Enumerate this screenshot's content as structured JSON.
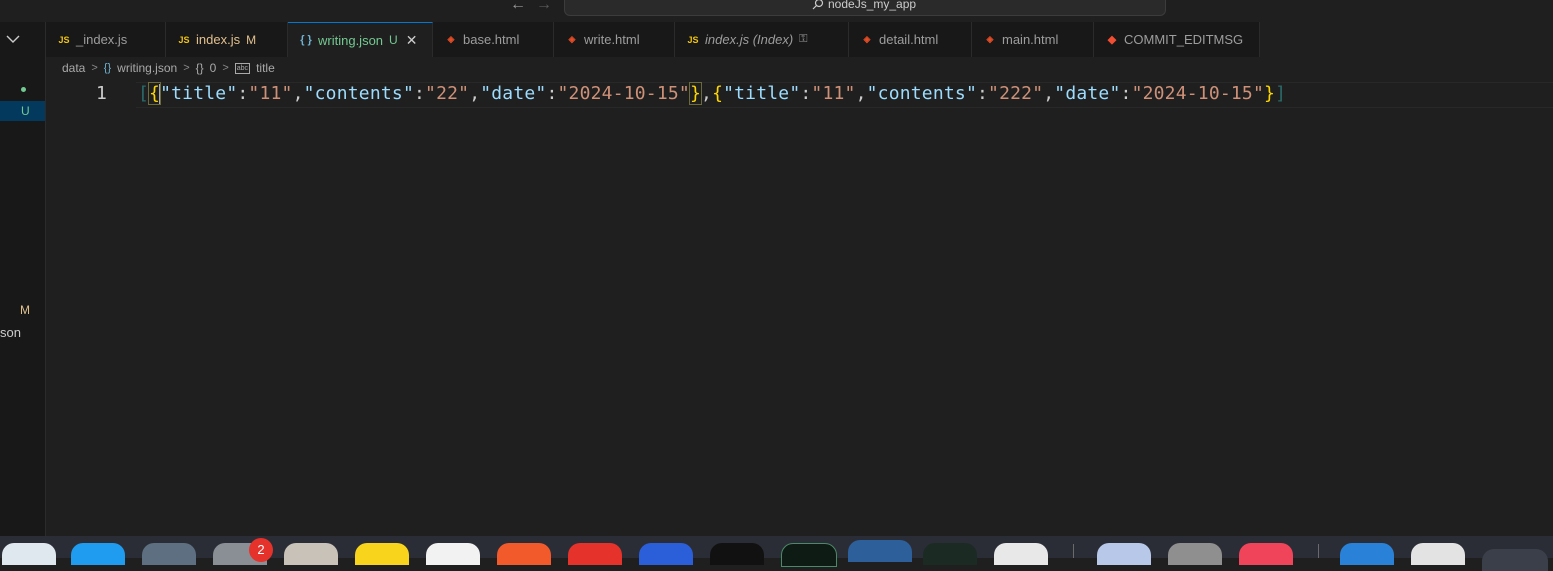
{
  "titlebar": {
    "search_text": "nodeJs_my_app"
  },
  "gutter": {
    "u_badge": "U",
    "m_badge": "M",
    "truncated_file": "son"
  },
  "tabs": [
    {
      "label": "_index.js",
      "icon": "js-icon",
      "badge": "",
      "active": false
    },
    {
      "label": "index.js",
      "icon": "js-icon",
      "badge": "M",
      "active": false
    },
    {
      "label": "writing.json",
      "icon": "json-icon",
      "badge": "U",
      "active": true
    },
    {
      "label": "base.html",
      "icon": "html-icon",
      "badge": "",
      "active": false
    },
    {
      "label": "write.html",
      "icon": "html-icon",
      "badge": "",
      "active": false
    },
    {
      "label": "index.js (Index)",
      "icon": "js-icon",
      "badge": "",
      "active": false,
      "readonly": true
    },
    {
      "label": "detail.html",
      "icon": "html-icon",
      "badge": "",
      "active": false
    },
    {
      "label": "main.html",
      "icon": "html-icon",
      "badge": "",
      "active": false
    },
    {
      "label": "COMMIT_EDITMSG",
      "icon": "git-icon",
      "badge": "",
      "active": false
    }
  ],
  "breadcrumb": {
    "folder": "data",
    "file": "writing.json",
    "index": "0",
    "field": "title"
  },
  "editor": {
    "line_number": "1",
    "records": [
      {
        "title_key": "\"title\"",
        "title_val": "\"11\"",
        "contents_key": "\"contents\"",
        "contents_val": "\"22\"",
        "date_key": "\"date\"",
        "date_val": "\"2024-10-15\""
      },
      {
        "title_key": "\"title\"",
        "title_val": "\"11\"",
        "contents_key": "\"contents\"",
        "contents_val": "\"222\"",
        "date_key": "\"date\"",
        "date_val": "\"2024-10-15\""
      }
    ]
  },
  "dock": {
    "badge_count": "2"
  },
  "colors": {
    "accent": "#0078d4",
    "untracked": "#73c991",
    "modified": "#e2c08d",
    "json_key": "#9cdcfe",
    "json_string": "#ce9178",
    "brace": "#ffd700"
  }
}
